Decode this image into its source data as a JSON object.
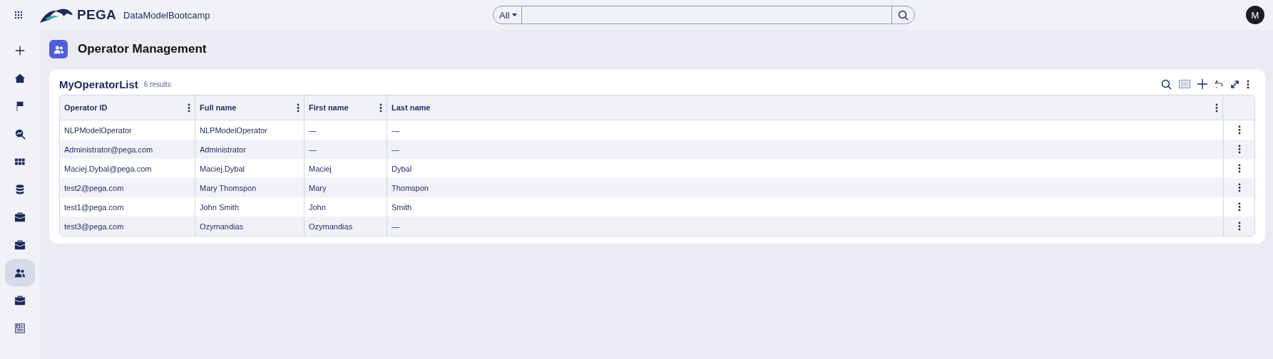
{
  "header": {
    "brand": "PEGA",
    "app_name": "DataModelBootcamp",
    "search": {
      "scope": "All"
    },
    "avatar": "M"
  },
  "sidebar": {
    "items": [
      {
        "kind": "add",
        "selected": false
      },
      {
        "kind": "home",
        "selected": false
      },
      {
        "kind": "flag",
        "selected": false
      },
      {
        "kind": "analytics",
        "selected": false
      },
      {
        "kind": "apps",
        "selected": false
      },
      {
        "kind": "database",
        "selected": false
      },
      {
        "kind": "case",
        "selected": false
      },
      {
        "kind": "case",
        "selected": false
      },
      {
        "kind": "people",
        "selected": true
      },
      {
        "kind": "case",
        "selected": false
      },
      {
        "kind": "report",
        "selected": false
      }
    ]
  },
  "page": {
    "title": "Operator Management"
  },
  "list": {
    "title": "MyOperatorList",
    "count": "6 results",
    "columns": [
      "Operator ID",
      "Full name",
      "First name",
      "Last name"
    ],
    "rows": [
      [
        "NLPModelOperator",
        "NLPModelOperator",
        "—",
        "—"
      ],
      [
        "Administrator@pega.com",
        "Administrator",
        "—",
        "—"
      ],
      [
        "Maciej.Dybal@pega.com",
        "Maciej.Dybal",
        "Maciej",
        "Dybal"
      ],
      [
        "test2@pega.com",
        "Mary Thomspon",
        "Mary",
        "Thomspon"
      ],
      [
        "test1@pega.com",
        "John Smith",
        "John",
        "Smith"
      ],
      [
        "test3@pega.com",
        "Ozymandias",
        "Ozymandias",
        "—"
      ]
    ]
  }
}
